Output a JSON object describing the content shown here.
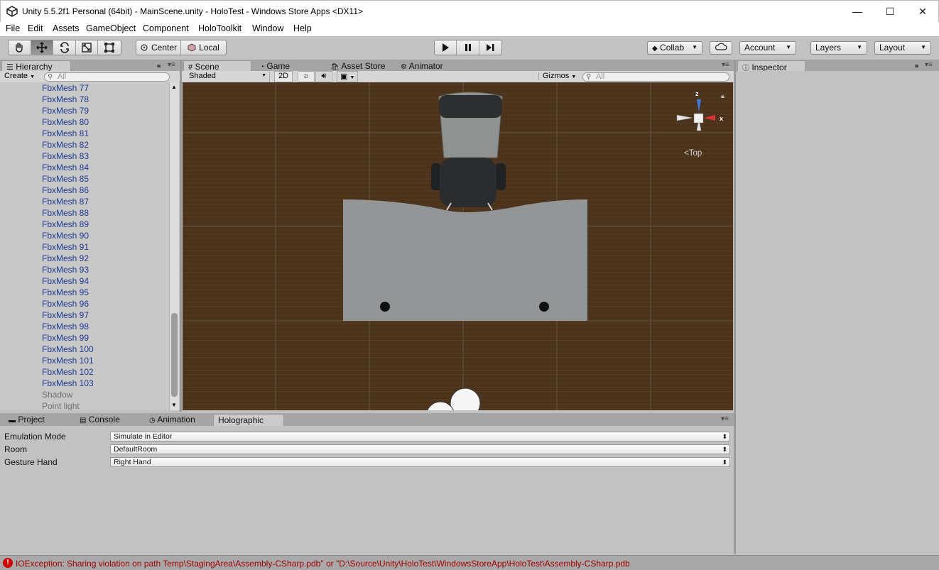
{
  "window": {
    "title": "Unity 5.5.2f1 Personal (64bit) - MainScene.unity - HoloTest - Windows Store Apps <DX11>",
    "minimize": "—",
    "maximize": "☐",
    "close": "✕"
  },
  "menu": [
    "File",
    "Edit",
    "Assets",
    "GameObject",
    "Component",
    "HoloToolkit",
    "Window",
    "Help"
  ],
  "toolbar": {
    "pivot": "Center",
    "space": "Local",
    "collab": "Collab",
    "account": "Account",
    "layers": "Layers",
    "layout": "Layout"
  },
  "hierarchy": {
    "tab": "Hierarchy",
    "create": "Create",
    "search_placeholder": "All",
    "items": [
      "FbxMesh 77",
      "FbxMesh 78",
      "FbxMesh 79",
      "FbxMesh 80",
      "FbxMesh 81",
      "FbxMesh 82",
      "FbxMesh 83",
      "FbxMesh 84",
      "FbxMesh 85",
      "FbxMesh 86",
      "FbxMesh 87",
      "FbxMesh 88",
      "FbxMesh 89",
      "FbxMesh 90",
      "FbxMesh 91",
      "FbxMesh 92",
      "FbxMesh 93",
      "FbxMesh 94",
      "FbxMesh 95",
      "FbxMesh 96",
      "FbxMesh 97",
      "FbxMesh 98",
      "FbxMesh 99",
      "FbxMesh 100",
      "FbxMesh 101",
      "FbxMesh 102",
      "FbxMesh 103"
    ],
    "inactive_items": [
      "Shadow",
      "Point light"
    ]
  },
  "scene": {
    "tabs": [
      "Scene",
      "Game",
      "Asset Store",
      "Animator"
    ],
    "draw_mode": "Shaded",
    "mode_2d": "2D",
    "gizmos": "Gizmos",
    "search_placeholder": "All",
    "view_label": "Top",
    "axis_z": "z",
    "axis_x": "x"
  },
  "bottom_tabs": [
    "Project",
    "Console",
    "Animation",
    "Holographic"
  ],
  "holographic": {
    "rows": [
      {
        "label": "Emulation Mode",
        "value": "Simulate in Editor"
      },
      {
        "label": "Room",
        "value": "DefaultRoom"
      },
      {
        "label": "Gesture Hand",
        "value": "Right Hand"
      }
    ]
  },
  "inspector": {
    "tab": "Inspector"
  },
  "status": {
    "error": "IOException: Sharing violation on path Temp\\StagingArea\\Assembly-CSharp.pdb\" or \"D:\\Source\\Unity\\HoloTest\\WindowsStoreApp\\HoloTest\\Assembly-CSharp.pdb"
  },
  "colors": {
    "scene_floor": "#4c341c",
    "desk": "#929696",
    "hierarchy_text": "#1c3a8f",
    "error_text": "#a00000"
  }
}
